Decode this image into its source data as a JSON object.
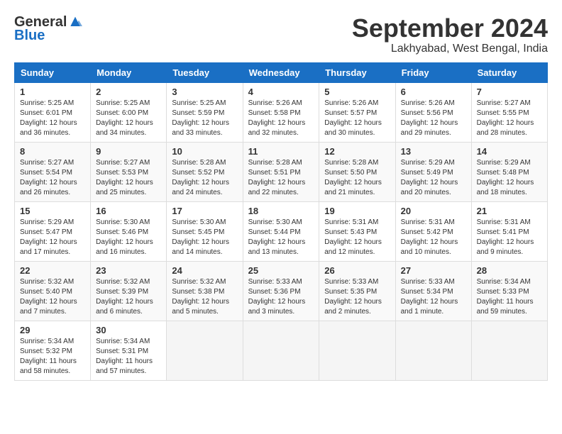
{
  "header": {
    "logo_general": "General",
    "logo_blue": "Blue",
    "month_title": "September 2024",
    "location": "Lakhyabad, West Bengal, India"
  },
  "columns": [
    "Sunday",
    "Monday",
    "Tuesday",
    "Wednesday",
    "Thursday",
    "Friday",
    "Saturday"
  ],
  "weeks": [
    [
      {
        "day": "1",
        "sunrise": "5:25 AM",
        "sunset": "6:01 PM",
        "daylight": "12 hours and 36 minutes."
      },
      {
        "day": "2",
        "sunrise": "5:25 AM",
        "sunset": "6:00 PM",
        "daylight": "12 hours and 34 minutes."
      },
      {
        "day": "3",
        "sunrise": "5:25 AM",
        "sunset": "5:59 PM",
        "daylight": "12 hours and 33 minutes."
      },
      {
        "day": "4",
        "sunrise": "5:26 AM",
        "sunset": "5:58 PM",
        "daylight": "12 hours and 32 minutes."
      },
      {
        "day": "5",
        "sunrise": "5:26 AM",
        "sunset": "5:57 PM",
        "daylight": "12 hours and 30 minutes."
      },
      {
        "day": "6",
        "sunrise": "5:26 AM",
        "sunset": "5:56 PM",
        "daylight": "12 hours and 29 minutes."
      },
      {
        "day": "7",
        "sunrise": "5:27 AM",
        "sunset": "5:55 PM",
        "daylight": "12 hours and 28 minutes."
      }
    ],
    [
      {
        "day": "8",
        "sunrise": "5:27 AM",
        "sunset": "5:54 PM",
        "daylight": "12 hours and 26 minutes."
      },
      {
        "day": "9",
        "sunrise": "5:27 AM",
        "sunset": "5:53 PM",
        "daylight": "12 hours and 25 minutes."
      },
      {
        "day": "10",
        "sunrise": "5:28 AM",
        "sunset": "5:52 PM",
        "daylight": "12 hours and 24 minutes."
      },
      {
        "day": "11",
        "sunrise": "5:28 AM",
        "sunset": "5:51 PM",
        "daylight": "12 hours and 22 minutes."
      },
      {
        "day": "12",
        "sunrise": "5:28 AM",
        "sunset": "5:50 PM",
        "daylight": "12 hours and 21 minutes."
      },
      {
        "day": "13",
        "sunrise": "5:29 AM",
        "sunset": "5:49 PM",
        "daylight": "12 hours and 20 minutes."
      },
      {
        "day": "14",
        "sunrise": "5:29 AM",
        "sunset": "5:48 PM",
        "daylight": "12 hours and 18 minutes."
      }
    ],
    [
      {
        "day": "15",
        "sunrise": "5:29 AM",
        "sunset": "5:47 PM",
        "daylight": "12 hours and 17 minutes."
      },
      {
        "day": "16",
        "sunrise": "5:30 AM",
        "sunset": "5:46 PM",
        "daylight": "12 hours and 16 minutes."
      },
      {
        "day": "17",
        "sunrise": "5:30 AM",
        "sunset": "5:45 PM",
        "daylight": "12 hours and 14 minutes."
      },
      {
        "day": "18",
        "sunrise": "5:30 AM",
        "sunset": "5:44 PM",
        "daylight": "12 hours and 13 minutes."
      },
      {
        "day": "19",
        "sunrise": "5:31 AM",
        "sunset": "5:43 PM",
        "daylight": "12 hours and 12 minutes."
      },
      {
        "day": "20",
        "sunrise": "5:31 AM",
        "sunset": "5:42 PM",
        "daylight": "12 hours and 10 minutes."
      },
      {
        "day": "21",
        "sunrise": "5:31 AM",
        "sunset": "5:41 PM",
        "daylight": "12 hours and 9 minutes."
      }
    ],
    [
      {
        "day": "22",
        "sunrise": "5:32 AM",
        "sunset": "5:40 PM",
        "daylight": "12 hours and 7 minutes."
      },
      {
        "day": "23",
        "sunrise": "5:32 AM",
        "sunset": "5:39 PM",
        "daylight": "12 hours and 6 minutes."
      },
      {
        "day": "24",
        "sunrise": "5:32 AM",
        "sunset": "5:38 PM",
        "daylight": "12 hours and 5 minutes."
      },
      {
        "day": "25",
        "sunrise": "5:33 AM",
        "sunset": "5:36 PM",
        "daylight": "12 hours and 3 minutes."
      },
      {
        "day": "26",
        "sunrise": "5:33 AM",
        "sunset": "5:35 PM",
        "daylight": "12 hours and 2 minutes."
      },
      {
        "day": "27",
        "sunrise": "5:33 AM",
        "sunset": "5:34 PM",
        "daylight": "12 hours and 1 minute."
      },
      {
        "day": "28",
        "sunrise": "5:34 AM",
        "sunset": "5:33 PM",
        "daylight": "11 hours and 59 minutes."
      }
    ],
    [
      {
        "day": "29",
        "sunrise": "5:34 AM",
        "sunset": "5:32 PM",
        "daylight": "11 hours and 58 minutes."
      },
      {
        "day": "30",
        "sunrise": "5:34 AM",
        "sunset": "5:31 PM",
        "daylight": "11 hours and 57 minutes."
      },
      null,
      null,
      null,
      null,
      null
    ]
  ]
}
